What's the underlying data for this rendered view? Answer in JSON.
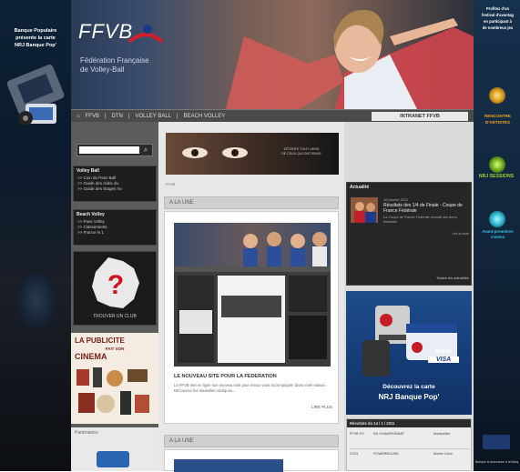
{
  "left_ad": {
    "title_lines": [
      "Banque Populaire",
      "présente la carte",
      "NRJ Banque Pop'"
    ]
  },
  "right_ad": {
    "intro_lines": [
      "Profitez d'un",
      "festival d'avantag",
      "en participant à",
      "de nombreux jeu"
    ],
    "items": [
      {
        "label": "RENCONTRE D'ARTISTES"
      },
      {
        "label": "NRJ SESSIONS"
      },
      {
        "label": "Avant-premières cinéma"
      }
    ],
    "footer": "Banque et assurance à la Banq"
  },
  "header": {
    "logo_text": "FFVB",
    "tagline_line1": "Fédération Française",
    "tagline_line2": "de Volley-Ball"
  },
  "nav": {
    "items": [
      "FFVB",
      "DTN",
      "VOLLEY BALL",
      "BEACH VOLLEY"
    ],
    "intranet_button": "INTRANET FFVB"
  },
  "search": {
    "placeholder": ""
  },
  "left_panels": [
    {
      "title": "Volley Ball",
      "links": [
        ">> Coin du Pass Ball",
        ">> Guide des clubs du",
        ">> Guide des Stages Vo"
      ]
    },
    {
      "title": "Beach Volley",
      "links": [
        ">> Pass Volley",
        ">> Classements",
        ">> France N 1"
      ]
    }
  ],
  "map_widget": {
    "caption": "TROUVER UN CLUB"
  },
  "publicite": {
    "lines": [
      "LA PUBLICITE",
      "FAIT SON",
      "CINEMA"
    ]
  },
  "partners": {
    "title": "Partenaires"
  },
  "center": {
    "small_label": "FFVB",
    "banner_text_line1": "DÉTENTE TOUT LIENS",
    "banner_text_line2": "DE CEUX QUI ONT ENVIE",
    "section1_title": "A LA UNE",
    "article_title": "LE NOUVEAU SITE POUR LA FEDERATION",
    "article_body": "La FFVB met en ligne son nouveau site pour mieux vous accompagner dans votre saison. Découvrez les nouvelles rubriques...",
    "read_more": "LIRE PLUS",
    "section2_title": "A LA UNE"
  },
  "actualite": {
    "title": "Actualité",
    "date": "16 janvier 2011",
    "headline": "Résultats des 1/4 de Finale - Coupe de France Fédérale",
    "body": "La Coupe de France Fédérale connaît ses demi-finalistes",
    "more": "Lire la suite",
    "all": "Toutes les actualités"
  },
  "nrj_ad": {
    "line1": "Découvrez la carte",
    "line2": "NRJ Banque Pop'",
    "card_label": "BLEUE",
    "card_brand": "VISA"
  },
  "results": {
    "title": "Résultats du 14 / 1 / 2011",
    "rows": [
      [
        "FFVB FV",
        "EN CHAMPIONNAT",
        "Montpellier"
      ],
      [
        "21/01",
        "POWERBOUND",
        "Monte Carlo"
      ]
    ]
  }
}
